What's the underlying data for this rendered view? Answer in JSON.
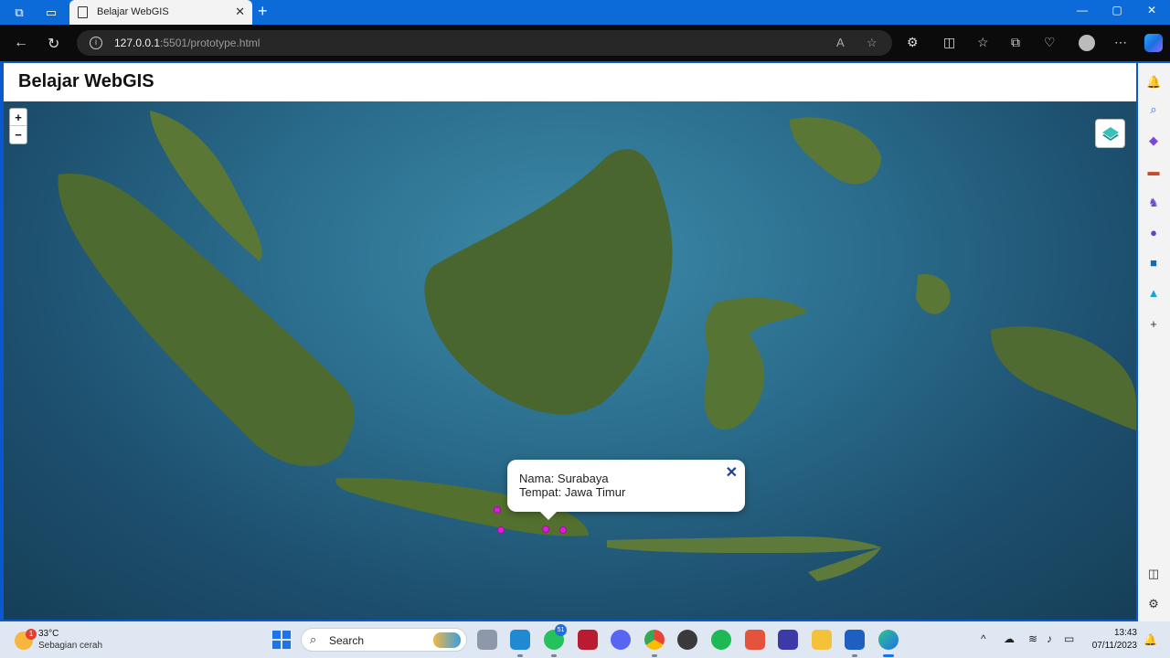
{
  "browser": {
    "tab_title": "Belajar WebGIS",
    "url_host": "127.0.0.1",
    "url_rest": ":5501/prototype.html"
  },
  "page": {
    "heading": "Belajar WebGIS"
  },
  "map": {
    "zoom_in_label": "+",
    "zoom_out_label": "−",
    "popup": {
      "line1": "Nama: Surabaya",
      "line2": "Tempat: Jawa Timur",
      "close_label": "✕"
    },
    "marker_color": "#e11ae0"
  },
  "taskbar": {
    "weather_temp": "33°C",
    "weather_desc": "Sebagian cerah",
    "weather_badge": "1",
    "search_label": "Search",
    "whatsapp_badge": "51",
    "time": "13:43",
    "date": "07/11/2023"
  },
  "colors": {
    "titlebar": "#0c6bd9",
    "toolbar": "#0b0b0b",
    "ocean": "#2c6f8f",
    "land": "#4f6b32"
  }
}
